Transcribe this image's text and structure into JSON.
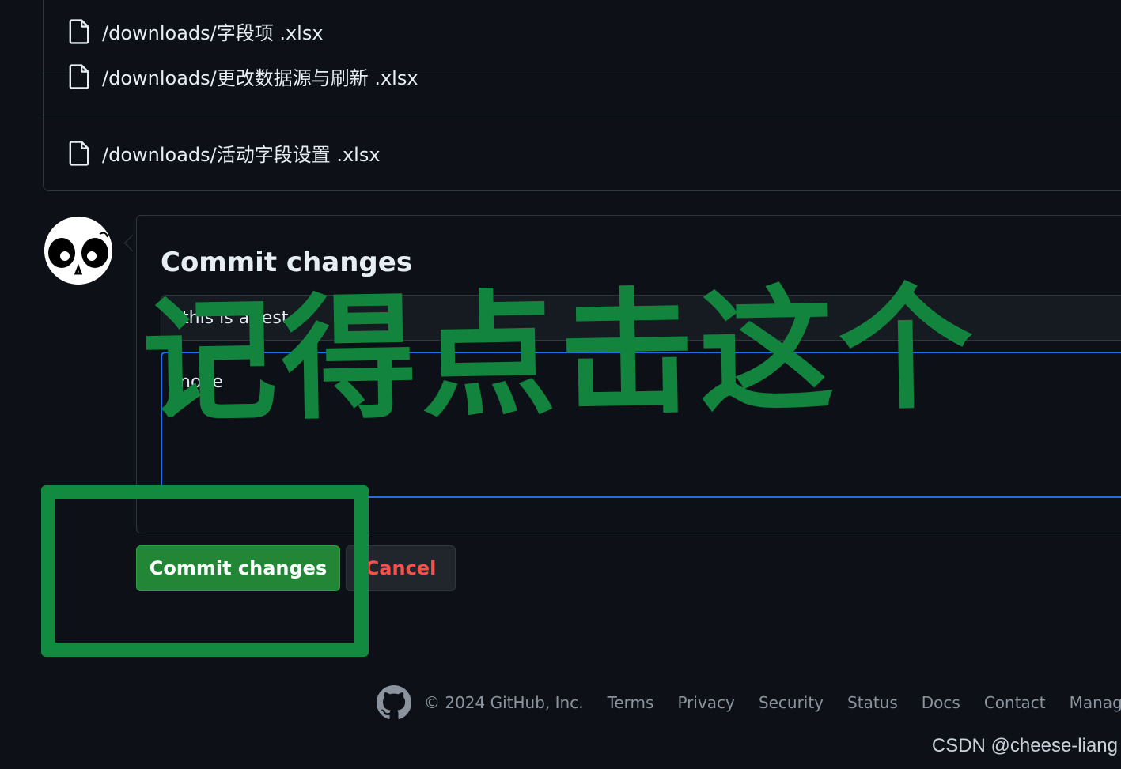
{
  "files": [
    {
      "path": "/downloads/字段项 .xlsx",
      "icon": "file-icon"
    },
    {
      "path": "/downloads/更改数据源与刷新 .xlsx",
      "icon": "file-icon"
    },
    {
      "path": "/downloads/活动字段设置 .xlsx",
      "icon": "file-icon"
    }
  ],
  "commit": {
    "title": "Commit changes",
    "summary_value": "this is a test",
    "description_value": "none",
    "commit_button": "Commit changes",
    "cancel_button": "Cancel"
  },
  "annotation": {
    "text": "记得点击这个",
    "color": "#13843e"
  },
  "footer": {
    "copyright": "© 2024 GitHub, Inc.",
    "links": [
      "Terms",
      "Privacy",
      "Security",
      "Status",
      "Docs",
      "Contact",
      "Manage c"
    ]
  },
  "watermark": "CSDN @cheese-liang",
  "colors": {
    "background": "#0d1117",
    "border": "#30363d",
    "commit_green": "#238636",
    "cancel_red": "#f85149",
    "focus_blue": "#1f6feb"
  }
}
